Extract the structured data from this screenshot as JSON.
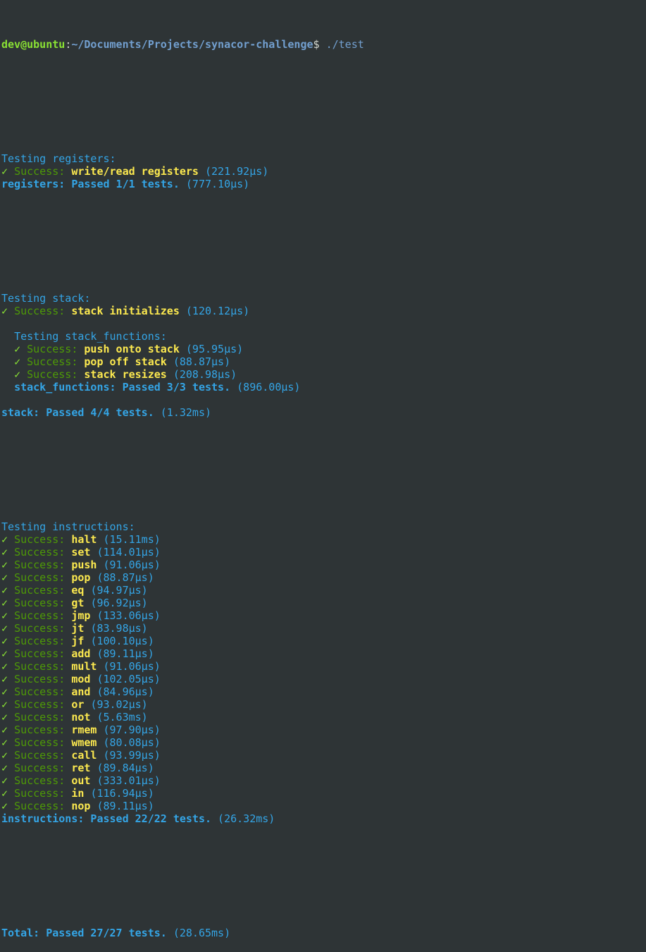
{
  "prompt": {
    "user_host": "dev@ubuntu",
    "separator": ":",
    "path": "~/Documents/Projects/synacor-challenge",
    "dollar": "$ ",
    "command": "./test"
  },
  "check_glyph": "✓ ",
  "success_label": "Success: ",
  "registers": {
    "heading": "Testing registers:",
    "tests": [
      {
        "name": "write/read registers",
        "time": "(221.92µs)"
      }
    ],
    "summary": "registers: Passed 1/1 tests.",
    "summary_time": "(777.10µs)"
  },
  "stack": {
    "heading": "Testing stack:",
    "tests": [
      {
        "name": "stack initializes",
        "time": "(120.12µs)"
      }
    ],
    "functions": {
      "heading": "Testing stack_functions:",
      "tests": [
        {
          "name": "push onto stack",
          "time": "(95.95µs)"
        },
        {
          "name": "pop off stack",
          "time": "(88.87µs)"
        },
        {
          "name": "stack resizes",
          "time": "(208.98µs)"
        }
      ],
      "summary": "stack_functions: Passed 3/3 tests.",
      "summary_time": "(896.00µs)"
    },
    "summary": "stack: Passed 4/4 tests.",
    "summary_time": "(1.32ms)"
  },
  "instructions": {
    "heading": "Testing instructions:",
    "tests": [
      {
        "name": "halt",
        "time": "(15.11ms)"
      },
      {
        "name": "set",
        "time": "(114.01µs)"
      },
      {
        "name": "push",
        "time": "(91.06µs)"
      },
      {
        "name": "pop",
        "time": "(88.87µs)"
      },
      {
        "name": "eq",
        "time": "(94.97µs)"
      },
      {
        "name": "gt",
        "time": "(96.92µs)"
      },
      {
        "name": "jmp",
        "time": "(133.06µs)"
      },
      {
        "name": "jt",
        "time": "(83.98µs)"
      },
      {
        "name": "jf",
        "time": "(100.10µs)"
      },
      {
        "name": "add",
        "time": "(89.11µs)"
      },
      {
        "name": "mult",
        "time": "(91.06µs)"
      },
      {
        "name": "mod",
        "time": "(102.05µs)"
      },
      {
        "name": "and",
        "time": "(84.96µs)"
      },
      {
        "name": "or",
        "time": "(93.02µs)"
      },
      {
        "name": "not",
        "time": "(5.63ms)"
      },
      {
        "name": "rmem",
        "time": "(97.90µs)"
      },
      {
        "name": "wmem",
        "time": "(80.08µs)"
      },
      {
        "name": "call",
        "time": "(93.99µs)"
      },
      {
        "name": "ret",
        "time": "(89.84µs)"
      },
      {
        "name": "out",
        "time": "(333.01µs)"
      },
      {
        "name": "in",
        "time": "(116.94µs)"
      },
      {
        "name": "nop",
        "time": "(89.11µs)"
      }
    ],
    "summary": "instructions: Passed 22/22 tests.",
    "summary_time": "(26.32ms)"
  },
  "total": {
    "summary": "Total: Passed 27/27 tests.",
    "summary_time": "(28.65ms)"
  },
  "colors": {
    "background": "#2e3436",
    "prompt_user": "#8ae234",
    "prompt_path": "#729fcf",
    "heading": "#34a5e6",
    "success": "#4e9a06",
    "test_name": "#fce94f"
  }
}
